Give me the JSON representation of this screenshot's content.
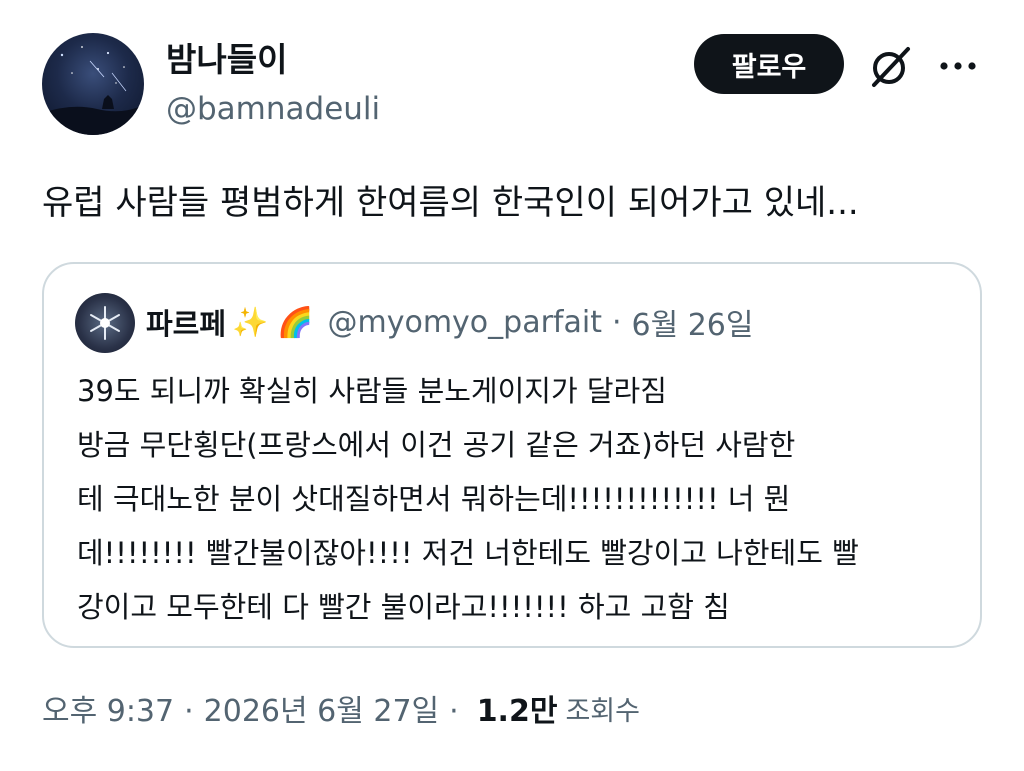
{
  "author": {
    "name": "밤나들이",
    "handle": "@bamnadeuli"
  },
  "follow_label": "팔로우",
  "icons": {
    "grok": "grok-icon",
    "more": "more-options-icon"
  },
  "tweet_text": "유럽 사람들 평범하게 한여름의 한국인이 되어가고 있네...",
  "quote": {
    "name": "파르페",
    "emoji": "✨ 🌈",
    "handle": "@myomyo_parfait",
    "separator": "·",
    "date": "6월 26일",
    "lines": [
      "39도 되니까 확실히 사람들 분노게이지가 달라짐",
      "방금 무단횡단(프랑스에서 이건 공기 같은 거죠)하던 사람한",
      "테 극대노한 분이 삿대질하면서 뭐하는데!!!!!!!!!!!!! 너 뭔",
      "데!!!!!!!! 빨간불이잖아!!!! 저건 너한테도 빨강이고 나한테도 빨",
      "강이고 모두한테 다 빨간 불이라고!!!!!!! 하고 고함 침"
    ]
  },
  "meta": {
    "time": "오후 9:37",
    "separator": "·",
    "date": "2026년 6월 27일",
    "views_count": "1.2만",
    "views_label": "조회수"
  },
  "colors": {
    "text": "#0f1419",
    "secondary": "#536471",
    "border": "#cfd9de",
    "button_bg": "#0f1419"
  }
}
